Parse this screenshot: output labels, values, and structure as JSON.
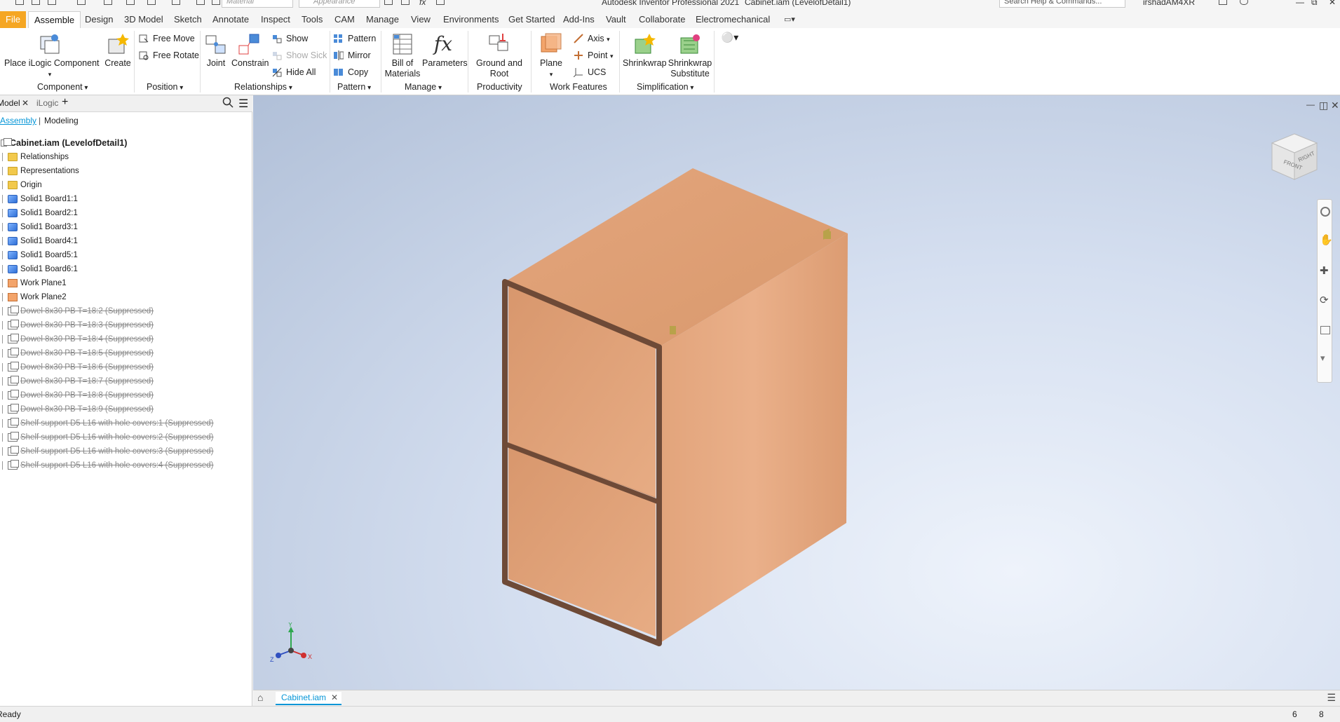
{
  "title_bar": {
    "app_title": "Autodesk Inventor Professional 2021",
    "doc_title": "Cabinet.iam (LevelofDetail1)",
    "material_placeholder": "Material",
    "appearance_placeholder": "Appearance",
    "search_placeholder": "Search Help & Commands...",
    "user": "irshadAM4XR"
  },
  "ribbon_tabs": [
    "File",
    "Assemble",
    "Design",
    "3D Model",
    "Sketch",
    "Annotate",
    "Inspect",
    "Tools",
    "CAM",
    "Manage",
    "View",
    "Environments",
    "Get Started",
    "Add-Ins",
    "Vault",
    "Collaborate",
    "Electromechanical"
  ],
  "active_tab": "Assemble",
  "ribbon": {
    "component": {
      "label": "Component",
      "place": "Place iLogic Component",
      "create": "Create"
    },
    "position": {
      "label": "Position",
      "free_move": "Free Move",
      "free_rotate": "Free Rotate"
    },
    "relationships": {
      "label": "Relationships",
      "joint": "Joint",
      "constrain": "Constrain",
      "show": "Show",
      "show_sick": "Show Sick",
      "hide_all": "Hide All"
    },
    "pattern": {
      "label": "Pattern",
      "pattern": "Pattern",
      "mirror": "Mirror",
      "copy": "Copy"
    },
    "manage": {
      "label": "Manage",
      "bom_1": "Bill of",
      "bom_2": "Materials",
      "parameters": "Parameters"
    },
    "productivity": {
      "label": "Productivity",
      "ground_1": "Ground and",
      "ground_2": "Root"
    },
    "work_features": {
      "label": "Work Features",
      "plane": "Plane",
      "axis": "Axis",
      "point": "Point",
      "ucs": "UCS"
    },
    "simplification": {
      "label": "Simplification",
      "shrinkwrap": "Shrinkwrap",
      "substitute_1": "Shrinkwrap",
      "substitute_2": "Substitute"
    }
  },
  "browser": {
    "tab_model": "Model",
    "tab_ilogic": "iLogic",
    "sub_assembly": "Assembly",
    "sub_modeling": "Modeling",
    "root": "Cabinet.iam (LevelofDetail1)",
    "items": [
      {
        "label": "Relationships",
        "icon": "folder"
      },
      {
        "label": "Representations",
        "icon": "folder"
      },
      {
        "label": "Origin",
        "icon": "folder"
      },
      {
        "label": "Solid1 Board1:1",
        "icon": "part"
      },
      {
        "label": "Solid1 Board2:1",
        "icon": "part"
      },
      {
        "label": "Solid1 Board3:1",
        "icon": "part"
      },
      {
        "label": "Solid1 Board4:1",
        "icon": "part"
      },
      {
        "label": "Solid1 Board5:1",
        "icon": "part"
      },
      {
        "label": "Solid1 Board6:1",
        "icon": "part"
      },
      {
        "label": "Work Plane1",
        "icon": "plane"
      },
      {
        "label": "Work Plane2",
        "icon": "plane"
      },
      {
        "label": "Dowel 8x30 PB T=18:2 (Suppressed)",
        "icon": "asm",
        "suppressed": true
      },
      {
        "label": "Dowel 8x30 PB T=18:3 (Suppressed)",
        "icon": "asm",
        "suppressed": true
      },
      {
        "label": "Dowel 8x30 PB T=18:4 (Suppressed)",
        "icon": "asm",
        "suppressed": true
      },
      {
        "label": "Dowel 8x30 PB T=18:5 (Suppressed)",
        "icon": "asm",
        "suppressed": true
      },
      {
        "label": "Dowel 8x30 PB T=18:6 (Suppressed)",
        "icon": "asm",
        "suppressed": true
      },
      {
        "label": "Dowel 8x30 PB T=18:7 (Suppressed)",
        "icon": "asm",
        "suppressed": true
      },
      {
        "label": "Dowel 8x30 PB T=18:8 (Suppressed)",
        "icon": "asm",
        "suppressed": true
      },
      {
        "label": "Dowel 8x30 PB T=18:9 (Suppressed)",
        "icon": "asm",
        "suppressed": true
      },
      {
        "label": "Shelf support D5 L16 with hole covers:1 (Suppressed)",
        "icon": "asm",
        "suppressed": true
      },
      {
        "label": "Shelf support D5 L16 with hole covers:2 (Suppressed)",
        "icon": "asm",
        "suppressed": true
      },
      {
        "label": "Shelf support D5 L16 with hole covers:3 (Suppressed)",
        "icon": "asm",
        "suppressed": true
      },
      {
        "label": "Shelf support D5 L16 with hole covers:4 (Suppressed)",
        "icon": "asm",
        "suppressed": true
      }
    ]
  },
  "viewcube": {
    "front": "FRONT",
    "right": "RIGHT"
  },
  "triad": {
    "x": "X",
    "y": "Y",
    "z": "Z"
  },
  "doc_tab": "Cabinet.iam",
  "status": {
    "text": "Ready",
    "count_a": "6",
    "count_b": "8"
  },
  "colors": {
    "accent": "#0696d7",
    "file_tab": "#f5a623",
    "wood": "#dfa078",
    "edge": "#6e4a37"
  }
}
